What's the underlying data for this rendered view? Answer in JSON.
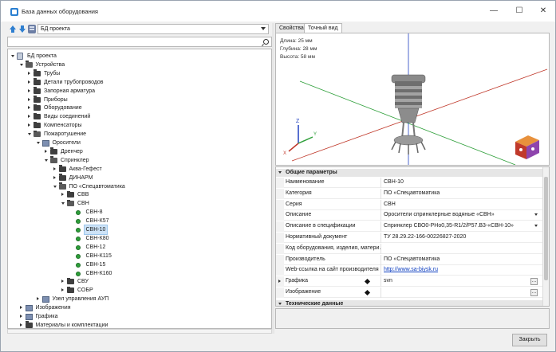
{
  "window": {
    "title": "База данных оборудования",
    "minimize": "—",
    "maximize": "☐",
    "close": "✕"
  },
  "toolbar": {
    "project_select": "БД проекта"
  },
  "search": {
    "placeholder": ""
  },
  "tree": [
    {
      "label": "БД проекта",
      "level": 0,
      "icon": "db",
      "exp": "open"
    },
    {
      "label": "Устройства",
      "level": 1,
      "icon": "folder-open",
      "exp": "open"
    },
    {
      "label": "Трубы",
      "level": 2,
      "icon": "folder",
      "exp": "closed"
    },
    {
      "label": "Детали трубопроводов",
      "level": 2,
      "icon": "folder",
      "exp": "closed"
    },
    {
      "label": "Запорная арматура",
      "level": 2,
      "icon": "folder",
      "exp": "closed"
    },
    {
      "label": "Приборы",
      "level": 2,
      "icon": "folder",
      "exp": "closed"
    },
    {
      "label": "Оборудование",
      "level": 2,
      "icon": "folder",
      "exp": "closed"
    },
    {
      "label": "Виды соединений",
      "level": 2,
      "icon": "folder",
      "exp": "closed"
    },
    {
      "label": "Компенсаторы",
      "level": 2,
      "icon": "folder",
      "exp": "closed"
    },
    {
      "label": "Пожаротушение",
      "level": 2,
      "icon": "folder-open",
      "exp": "open"
    },
    {
      "label": "Оросители",
      "level": 3,
      "icon": "cat",
      "exp": "open"
    },
    {
      "label": "Дренчер",
      "level": 4,
      "icon": "folder",
      "exp": "closed"
    },
    {
      "label": "Спринклер",
      "level": 4,
      "icon": "folder-open",
      "exp": "open"
    },
    {
      "label": "Аква-Гефест",
      "level": 5,
      "icon": "folder",
      "exp": "closed"
    },
    {
      "label": "ДИНАРМ",
      "level": 5,
      "icon": "folder",
      "exp": "closed"
    },
    {
      "label": "ПО «Спецавтоматика",
      "level": 5,
      "icon": "folder-open",
      "exp": "open"
    },
    {
      "label": "СВВ",
      "level": 6,
      "icon": "folder",
      "exp": "closed"
    },
    {
      "label": "СВН",
      "level": 6,
      "icon": "folder-open",
      "exp": "open"
    },
    {
      "label": "СВН-8",
      "level": 7,
      "icon": "dot",
      "exp": "none"
    },
    {
      "label": "СВН-К57",
      "level": 7,
      "icon": "dot",
      "exp": "none"
    },
    {
      "label": "СВН-10",
      "level": 7,
      "icon": "dot",
      "exp": "none",
      "selected": true
    },
    {
      "label": "СВН-К80",
      "level": 7,
      "icon": "dot",
      "exp": "none"
    },
    {
      "label": "СВН-12",
      "level": 7,
      "icon": "dot",
      "exp": "none"
    },
    {
      "label": "СВН-К115",
      "level": 7,
      "icon": "dot",
      "exp": "none"
    },
    {
      "label": "СВН-15",
      "level": 7,
      "icon": "dot",
      "exp": "none"
    },
    {
      "label": "СВН-К160",
      "level": 7,
      "icon": "dot",
      "exp": "none"
    },
    {
      "label": "СВУ",
      "level": 6,
      "icon": "folder",
      "exp": "closed"
    },
    {
      "label": "СОБР",
      "level": 6,
      "icon": "folder",
      "exp": "closed"
    },
    {
      "label": "Узел управления АУП",
      "level": 3,
      "icon": "cat",
      "exp": "closed"
    },
    {
      "label": "Изображения",
      "level": 1,
      "icon": "cat",
      "exp": "closed"
    },
    {
      "label": "Графика",
      "level": 1,
      "icon": "cat",
      "exp": "closed"
    },
    {
      "label": "Материалы и комплектации",
      "level": 1,
      "icon": "folder",
      "exp": "closed"
    }
  ],
  "tabs": [
    {
      "label": "Свойства",
      "active": false
    },
    {
      "label": "Точный вид",
      "active": true
    }
  ],
  "viewport": {
    "dims": [
      "Длина: 25 мм",
      "Глубина: 28 мм",
      "Высота: 58 мм"
    ],
    "axis_z": "Z",
    "axis_x": "X",
    "axis_y": "Y"
  },
  "properties": {
    "section_general": "Общие параметры",
    "rows": [
      {
        "key": "Наименование",
        "value": "СВН-10"
      },
      {
        "key": "Категория",
        "value": "ПО «Спецавтоматика"
      },
      {
        "key": "Серия",
        "value": "СВН"
      },
      {
        "key": "Описание",
        "value": "Оросители спринклерные водяные «СВН»",
        "dropdown": true
      },
      {
        "key": "Описание в спецификации",
        "value": "Спринклер СВО0-РНо0,35-R1/2/Р57.В3-«СВН-10»",
        "dropdown": true
      },
      {
        "key": "Нормативный документ",
        "value": "ТУ 28.29.22-166-00226827-2020"
      },
      {
        "key": "Код оборудования, изделия, матери...",
        "value": ""
      },
      {
        "key": "Производитель",
        "value": "ПО «Спецавтоматика"
      },
      {
        "key": "Web-ссылка на сайт производителя",
        "value": "http://www.sa-biysk.ru",
        "link": true
      },
      {
        "key": "Графика",
        "value": "svn",
        "expandable": true,
        "diamond": true,
        "ellipsis": true
      },
      {
        "key": "Изображение",
        "value": "",
        "diamond": true,
        "ellipsis": true
      }
    ],
    "section_tech": "Технические данные"
  },
  "footer": {
    "close_label": "Закрыть"
  },
  "colors": {
    "selection": "#cde3f7",
    "leaf_dot": "#2e9f3a",
    "link": "#1040c0",
    "axis_x": "#c0392b",
    "axis_y": "#2e9f3a",
    "axis_z": "#2040c0"
  }
}
